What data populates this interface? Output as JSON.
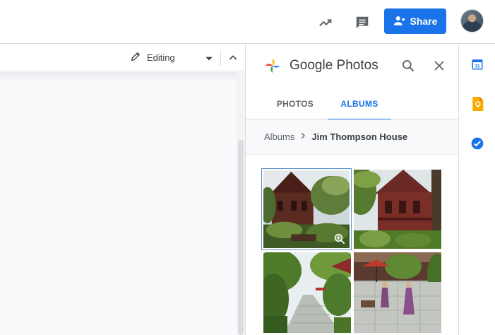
{
  "header": {
    "share_label": "Share",
    "icons": [
      "trending-icon",
      "comment-icon",
      "share-person-icon",
      "avatar"
    ]
  },
  "doc_toolbar": {
    "mode_label": "Editing",
    "icons": [
      "pencil-icon",
      "caret-down-icon",
      "chevron-up-icon"
    ]
  },
  "photos_panel": {
    "title": "Google Photos",
    "tabs": [
      {
        "label": "PHOTOS",
        "active": false
      },
      {
        "label": "ALBUMS",
        "active": true
      }
    ],
    "breadcrumb": {
      "root": "Albums",
      "current": "Jim Thompson House"
    },
    "photos": [
      {
        "name": "thai-house-garden-photo",
        "selected": true
      },
      {
        "name": "red-teak-house-photo",
        "selected": false
      },
      {
        "name": "garden-walkway-photo",
        "selected": false
      },
      {
        "name": "courtyard-people-photo",
        "selected": false
      }
    ]
  },
  "side_rail": {
    "calendar_day": "31",
    "icons": [
      "calendar-icon",
      "keep-icon",
      "tasks-icon"
    ]
  },
  "colors": {
    "accent": "#1a73e8",
    "text": "#3c4043",
    "muted": "#5f6368",
    "border": "#dadce0"
  }
}
